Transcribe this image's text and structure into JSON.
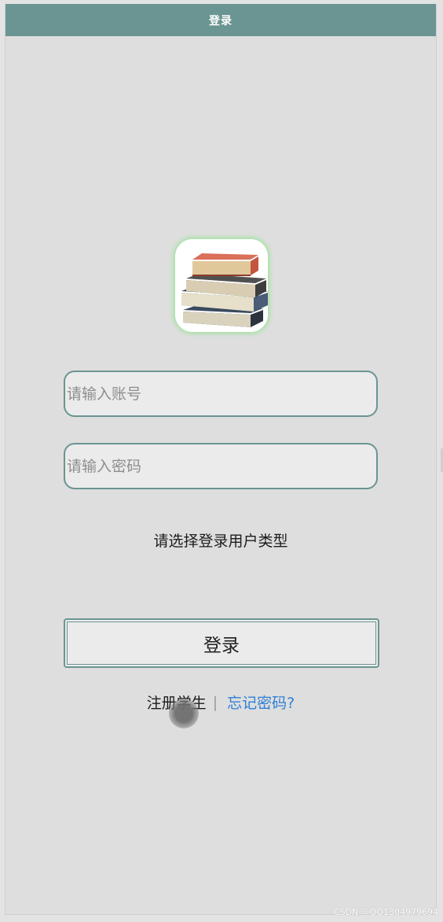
{
  "header": {
    "title": "登录"
  },
  "logo": {
    "icon": "books-stack-icon"
  },
  "form": {
    "account_placeholder": "请输入账号",
    "password_placeholder": "请输入密码",
    "user_type_prompt": "请选择登录用户类型",
    "login_label": "登录"
  },
  "links": {
    "register_label": "注册学生",
    "separator": "|",
    "forgot_label": "忘记密码?"
  },
  "watermark": "CSDN @QQ1304979694",
  "colors": {
    "header": "#6a9592",
    "accent_border": "#6a9592",
    "link": "#2f7fd6",
    "background": "#dedede"
  }
}
